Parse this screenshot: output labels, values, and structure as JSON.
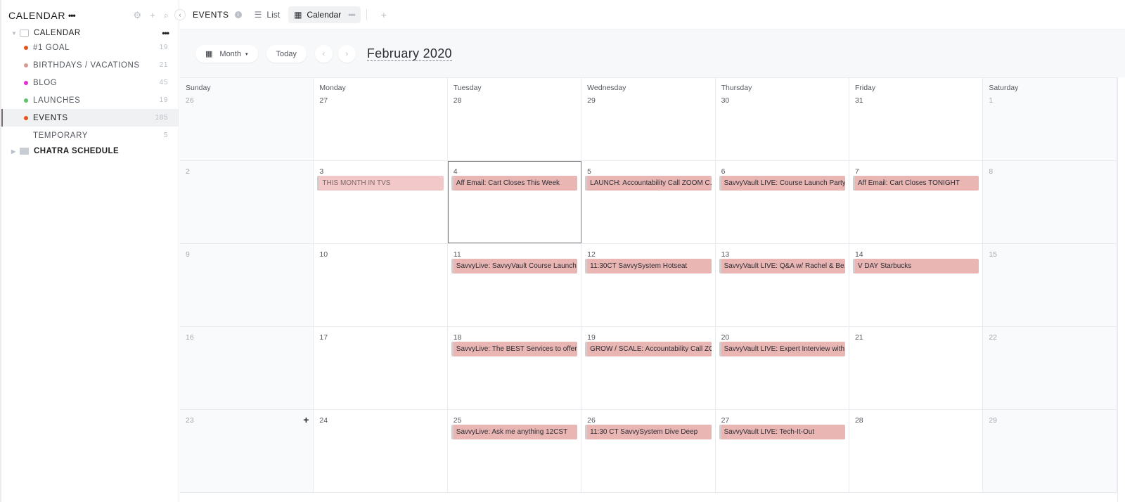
{
  "sidebar": {
    "title": "CALENDAR",
    "title_more": "•••",
    "actions": {
      "settings_icon": "⚙",
      "add_icon": "+",
      "search_icon": "⌕"
    },
    "folder": {
      "label": "CALENDAR",
      "more": "•••"
    },
    "items": [
      {
        "label": "#1 GOAL",
        "count": "19",
        "color": "#e2551c"
      },
      {
        "label": "BIRTHDAYS / VACATIONS",
        "count": "21",
        "color": "#d69b93"
      },
      {
        "label": "BLOG",
        "count": "45",
        "color": "#e52fd5"
      },
      {
        "label": "LAUNCHES",
        "count": "19",
        "color": "#5cc46a"
      },
      {
        "label": "EVENTS",
        "count": "185",
        "color": "#e2551c",
        "active": true
      },
      {
        "label": "TEMPORARY",
        "count": "5",
        "color": ""
      }
    ],
    "folder2": {
      "label": "CHATRA SCHEDULE"
    }
  },
  "topbar": {
    "collapse_icon": "‹",
    "title": "EVENTS",
    "info_icon": "i",
    "tabs": [
      {
        "label": "List",
        "icon": "☰"
      },
      {
        "label": "Calendar",
        "icon": "▦",
        "more": "•••",
        "active": true
      }
    ],
    "add_icon": "+"
  },
  "toolbar": {
    "view_icon": "▦",
    "view_label": "Month",
    "view_caret": "▾",
    "today_label": "Today",
    "prev_icon": "‹",
    "next_icon": "›",
    "month_title": "February 2020"
  },
  "calendar": {
    "weekdays": [
      "Sunday",
      "Monday",
      "Tuesday",
      "Wednesday",
      "Thursday",
      "Friday",
      "Saturday"
    ],
    "weeks": [
      [
        {
          "day": "26",
          "faded": true
        },
        {
          "day": "27"
        },
        {
          "day": "28"
        },
        {
          "day": "29"
        },
        {
          "day": "30"
        },
        {
          "day": "31"
        },
        {
          "day": "1",
          "faded": true
        }
      ],
      [
        {
          "day": "2",
          "faded": true
        },
        {
          "day": "3",
          "event": "THIS MONTH IN TVS",
          "dotted": true
        },
        {
          "day": "4",
          "event": "Aff Email: Cart Closes This Week",
          "today": true
        },
        {
          "day": "5",
          "event": "LAUNCH: Accountability Call ZOOM C..."
        },
        {
          "day": "6",
          "event": "SavvyVault LIVE: Course Launch Party"
        },
        {
          "day": "7",
          "event": "Aff Email: Cart Closes TONIGHT"
        },
        {
          "day": "8",
          "faded": true
        }
      ],
      [
        {
          "day": "9",
          "faded": true
        },
        {
          "day": "10"
        },
        {
          "day": "11",
          "event": "SavvyLive: SavvyVault Course Launch"
        },
        {
          "day": "12",
          "event": "11:30CT SavvySystem Hotseat"
        },
        {
          "day": "13",
          "event": "SavvyVault LIVE: Q&A w/ Rachel & Be..."
        },
        {
          "day": "14",
          "event": "V DAY Starbucks"
        },
        {
          "day": "15",
          "faded": true
        }
      ],
      [
        {
          "day": "16",
          "faded": true
        },
        {
          "day": "17"
        },
        {
          "day": "18",
          "event": "SavvyLive: The BEST Services to offer"
        },
        {
          "day": "19",
          "event": "GROW / SCALE: Accountability Call ZO..."
        },
        {
          "day": "20",
          "event": "SavvyVault LIVE: Expert Interview with..."
        },
        {
          "day": "21"
        },
        {
          "day": "22",
          "faded": true
        }
      ],
      [
        {
          "day": "23",
          "faded": true,
          "add": "+"
        },
        {
          "day": "24"
        },
        {
          "day": "25",
          "event": "SavvyLive: Ask me anything 12CST"
        },
        {
          "day": "26",
          "event": "11:30 CT SavvySystem Dive Deep"
        },
        {
          "day": "27",
          "event": "SavvyVault LIVE: Tech-It-Out"
        },
        {
          "day": "28"
        },
        {
          "day": "29",
          "faded": true
        }
      ]
    ]
  }
}
